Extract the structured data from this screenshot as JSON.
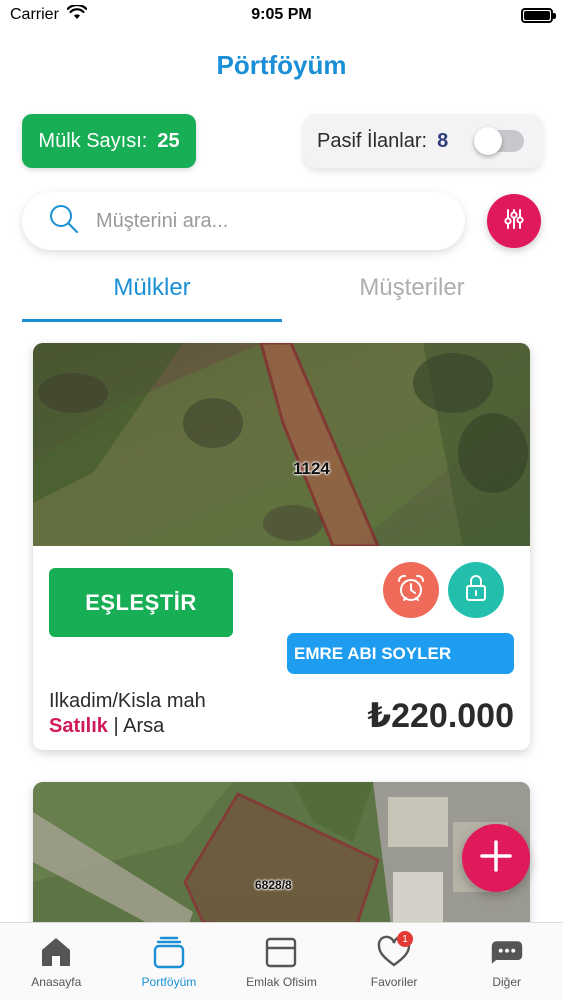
{
  "status_bar": {
    "carrier": "Carrier",
    "time": "9:05 PM"
  },
  "header": {
    "title": "Pörtföyüm"
  },
  "stats": {
    "property_count_label": "Mülk Sayısı:",
    "property_count": "25",
    "passive_label": "Pasif İlanlar:",
    "passive_count": "8",
    "passive_toggle_on": false
  },
  "search": {
    "placeholder": "Müşterini ara..."
  },
  "tabs": [
    {
      "label": "Mülkler",
      "active": true
    },
    {
      "label": "Müşteriler",
      "active": false
    }
  ],
  "listings": [
    {
      "parcel_no": "1124",
      "match_label": "EŞLEŞTİR",
      "client": "EMRE ABI SOYLER",
      "location": "Ilkadim/Kisla mah",
      "status": "Satılık",
      "separator": "|",
      "type": "Arsa",
      "price": "₺220.000"
    },
    {
      "parcel_no": "6828/8"
    }
  ],
  "bottom_nav": [
    {
      "label": "Anasayfa",
      "icon": "home-icon",
      "active": false
    },
    {
      "label": "Portföyüm",
      "icon": "portfolio-icon",
      "active": true
    },
    {
      "label": "Emlak Ofisim",
      "icon": "office-box-icon",
      "active": false
    },
    {
      "label": "Favoriler",
      "icon": "heart-icon",
      "active": false,
      "badge": "1"
    },
    {
      "label": "Diğer",
      "icon": "more-icon",
      "active": false
    }
  ],
  "colors": {
    "accent_blue": "#1b8fd6",
    "green": "#18ae56",
    "pink": "#e0195a",
    "alarm": "#ef6a58",
    "lock": "#22c0ac",
    "client_tag": "#1e9df0"
  }
}
